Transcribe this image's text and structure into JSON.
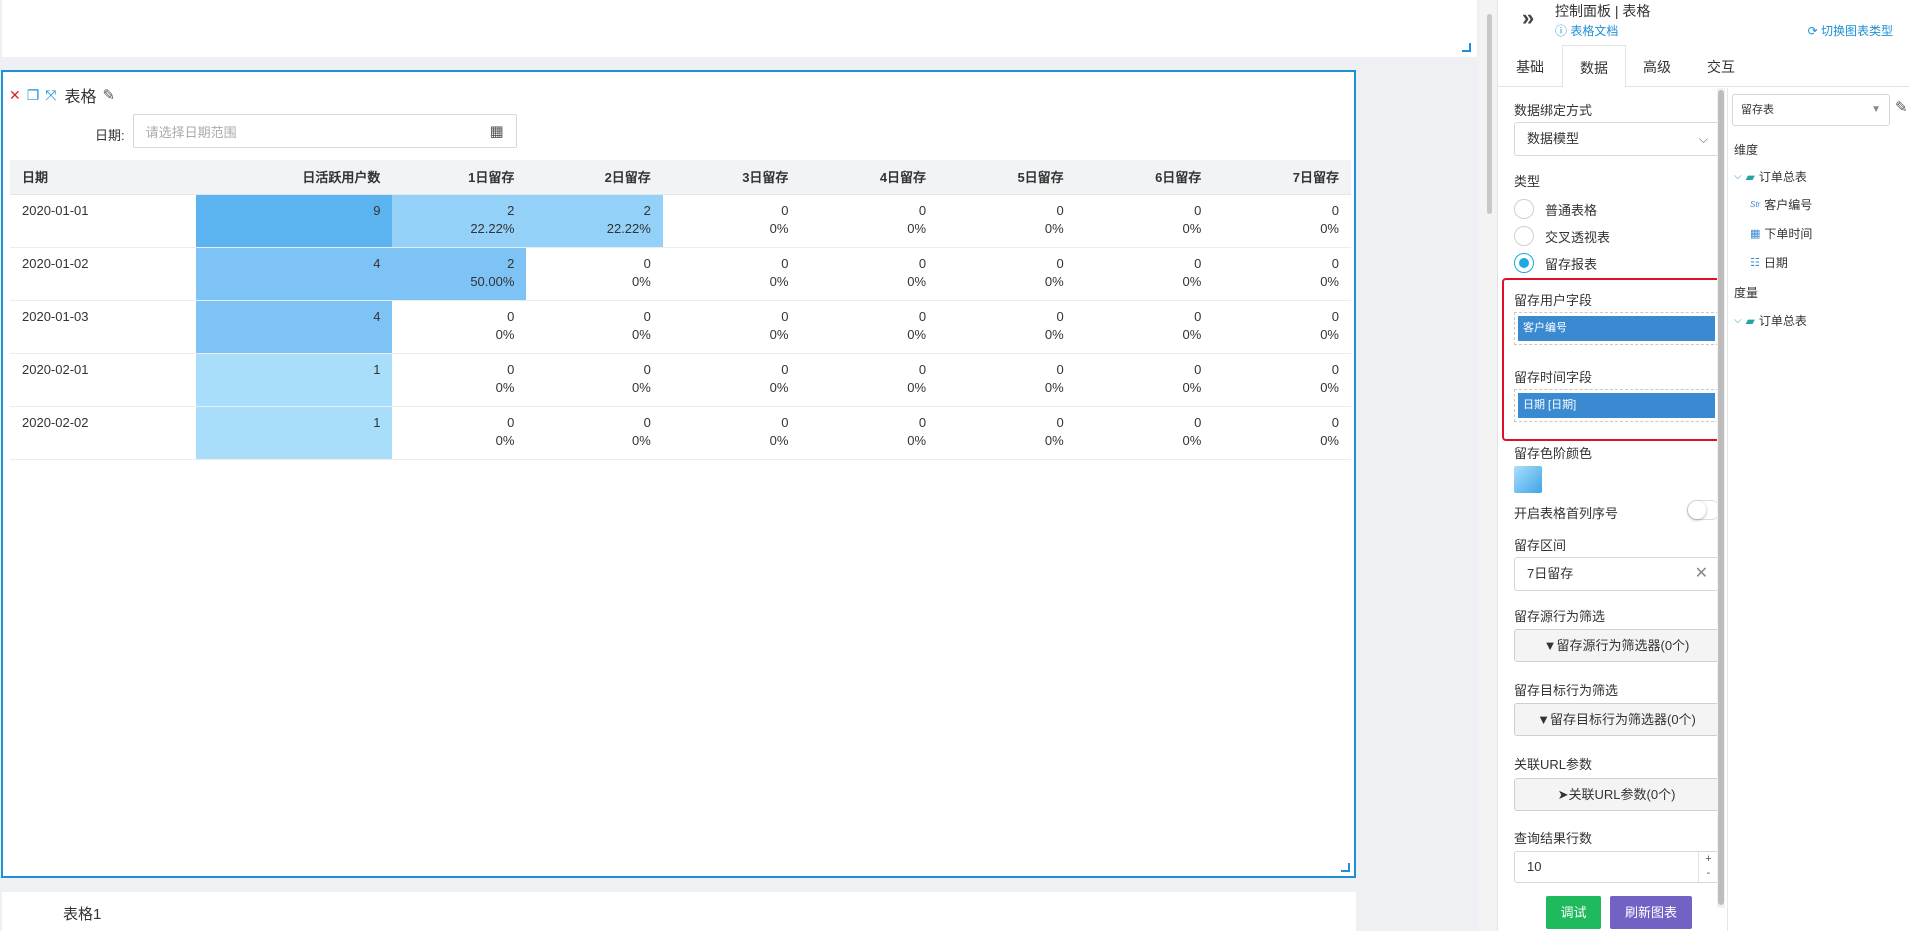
{
  "widget": {
    "title": "表格",
    "date_label": "日期:",
    "date_placeholder": "请选择日期范围"
  },
  "table": {
    "headers": [
      "日期",
      "日活跃用户数",
      "1日留存",
      "2日留存",
      "3日留存",
      "4日留存",
      "5日留存",
      "6日留存",
      "7日留存"
    ],
    "rows": [
      {
        "date": "2020-01-01",
        "dau": "9",
        "cells": [
          [
            "2",
            "22.22%"
          ],
          [
            "2",
            "22.22%"
          ],
          [
            "0",
            "0%"
          ],
          [
            "0",
            "0%"
          ],
          [
            "0",
            "0%"
          ],
          [
            "0",
            "0%"
          ],
          [
            "0",
            "0%"
          ]
        ]
      },
      {
        "date": "2020-01-02",
        "dau": "4",
        "cells": [
          [
            "2",
            "50.00%"
          ],
          [
            "0",
            "0%"
          ],
          [
            "0",
            "0%"
          ],
          [
            "0",
            "0%"
          ],
          [
            "0",
            "0%"
          ],
          [
            "0",
            "0%"
          ],
          [
            "0",
            "0%"
          ]
        ]
      },
      {
        "date": "2020-01-03",
        "dau": "4",
        "cells": [
          [
            "0",
            "0%"
          ],
          [
            "0",
            "0%"
          ],
          [
            "0",
            "0%"
          ],
          [
            "0",
            "0%"
          ],
          [
            "0",
            "0%"
          ],
          [
            "0",
            "0%"
          ],
          [
            "0",
            "0%"
          ]
        ]
      },
      {
        "date": "2020-02-01",
        "dau": "1",
        "cells": [
          [
            "0",
            "0%"
          ],
          [
            "0",
            "0%"
          ],
          [
            "0",
            "0%"
          ],
          [
            "0",
            "0%"
          ],
          [
            "0",
            "0%"
          ],
          [
            "0",
            "0%"
          ],
          [
            "0",
            "0%"
          ]
        ]
      },
      {
        "date": "2020-02-02",
        "dau": "1",
        "cells": [
          [
            "0",
            "0%"
          ],
          [
            "0",
            "0%"
          ],
          [
            "0",
            "0%"
          ],
          [
            "0",
            "0%"
          ],
          [
            "0",
            "0%"
          ],
          [
            "0",
            "0%"
          ],
          [
            "0",
            "0%"
          ]
        ]
      }
    ],
    "colors": {
      "dau_9": "#5bb3f0",
      "dau_4": "#7dc3f5",
      "dau_1": "#a8defa",
      "retain_22": "#93d1f9",
      "retain_50": "#7dc3f5"
    }
  },
  "card2": {
    "title": "表格1"
  },
  "panel": {
    "title": "控制面板 | 表格",
    "doc_link": "表格文档",
    "switch_link": "切换图表类型",
    "tabs": [
      "基础",
      "数据",
      "高级",
      "交互"
    ],
    "binding_label": "数据绑定方式",
    "binding_value": "数据模型",
    "type_label": "类型",
    "type_options": [
      "普通表格",
      "交叉透视表",
      "留存报表"
    ],
    "selected_type": "留存报表",
    "user_field_label": "留存用户字段",
    "user_field_value": "客户编号",
    "time_field_label": "留存时间字段",
    "time_field_value": "日期 [日期]",
    "color_label": "留存色阶颜色",
    "index_toggle_label": "开启表格首列序号",
    "interval_label": "留存区间",
    "interval_value": "7日留存",
    "source_filter_label": "留存源行为筛选",
    "source_filter_button": "留存源行为筛选器(0个)",
    "target_filter_label": "留存目标行为筛选",
    "target_filter_button": "留存目标行为筛选器(0个)",
    "url_param_label": "关联URL参数",
    "url_param_button": "关联URL参数(0个)",
    "rows_label": "查询结果行数",
    "rows_value": "10",
    "debug_button": "调试",
    "refresh_button": "刷新图表"
  },
  "tree": {
    "model_select": "留存表",
    "dimension_label": "维度",
    "dim_folder": "订单总表",
    "dim_fields": [
      "客户编号",
      "下单时间",
      "日期"
    ],
    "measure_label": "度量",
    "measure_folder": "订单总表"
  },
  "accent": "#1e90d6",
  "highlight_color": "#e00f2a"
}
